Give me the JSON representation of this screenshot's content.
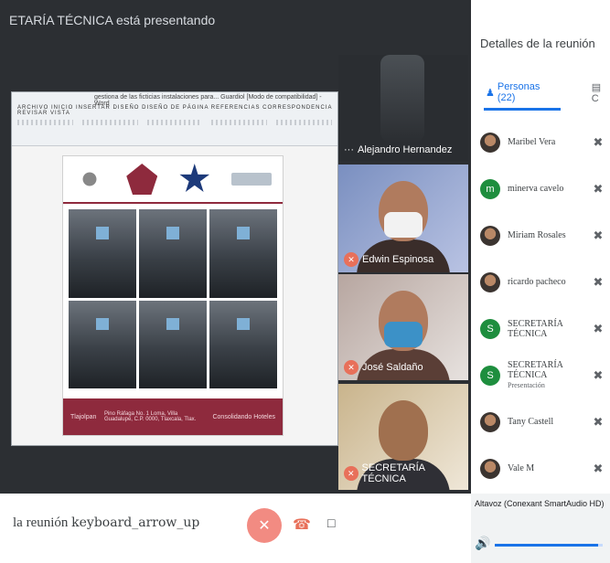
{
  "banner": "ETARÍA TÉCNICA está presentando",
  "slide": {
    "doc_title": "gestiona de las ficticias instalaciones para...  Guardiol  [Modo de compatibilidad]  -  Word",
    "ribbon_tabs": "ARCHIVO  INICIO  INSERTAR  DISEÑO  DISEÑO DE PÁGINA  REFERENCIAS  CORRESPONDENCIA  REVISAR  VISTA",
    "footer_left": "Tlajolpan",
    "footer_mid": "Pino Ráfaga No. 1 Loma, Villa Guadalupe, C.P. 0000, Tlaxcala, Tlax.",
    "footer_right": "Consolidando Hoteles"
  },
  "tiles": [
    {
      "name": "Alejandro Hernandez"
    },
    {
      "name": "Edwin Espinosa"
    },
    {
      "name": "José Saldaño"
    },
    {
      "name": "SECRETARÍA TÉCNICA"
    }
  ],
  "panel": {
    "title": "Detalles de la reunión",
    "tab_people": "Personas (22)",
    "tab_chat": "C"
  },
  "participants": [
    {
      "name": "Maribel Vera",
      "initial": "",
      "sub": ""
    },
    {
      "name": "minerva cavelo",
      "initial": "m",
      "sub": ""
    },
    {
      "name": "Miriam Rosales",
      "initial": "",
      "sub": ""
    },
    {
      "name": "ricardo pacheco",
      "initial": "",
      "sub": ""
    },
    {
      "name": "SECRETARÍA TÉCNICA",
      "initial": "S",
      "sub": ""
    },
    {
      "name": "SECRETARÍA TÉCNICA",
      "initial": "S",
      "sub": "Presentación"
    },
    {
      "name": "Tany Castell",
      "initial": "",
      "sub": ""
    },
    {
      "name": "Vale M",
      "initial": "",
      "sub": ""
    }
  ],
  "bottombar": {
    "meeting_label": "la reunión",
    "keyboard_hint": "keyboard_arrow_up"
  },
  "audio": {
    "label": "Altavoz (Conexant SmartAudio HD)",
    "level": 0.96
  },
  "icons": {
    "mic_off": "mic-off-icon",
    "hangup": "call-end-icon",
    "captions": "captions-icon"
  }
}
